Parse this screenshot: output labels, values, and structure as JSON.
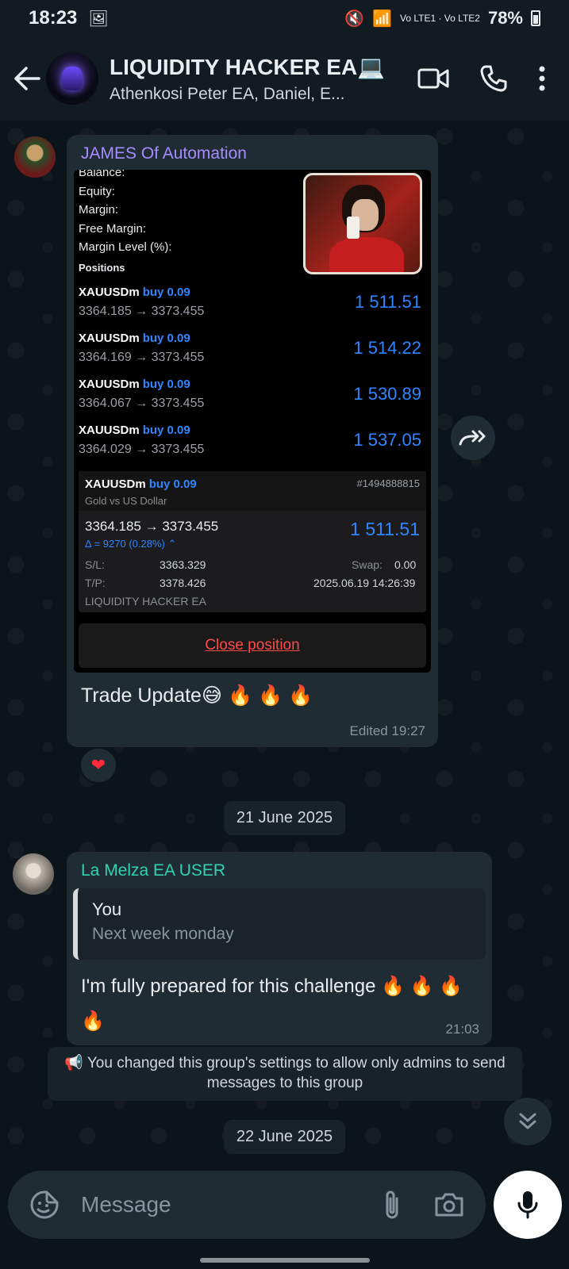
{
  "status_bar": {
    "time": "18:23",
    "network": "Vo LTE1 · Vo LTE2",
    "battery": "78%"
  },
  "header": {
    "title": "LIQUIDITY HACKER EA💻",
    "subtitle": "Athenkosi Peter EA, Daniel, E..."
  },
  "messages": {
    "first": {
      "sender": "JAMES Of Automation",
      "mt5": {
        "account_labels": [
          "Balance:",
          "Equity:",
          "Margin:",
          "Free Margin:",
          "Margin Level (%):"
        ],
        "positions_header": "Positions",
        "positions": [
          {
            "symbol": "XAUUSDm",
            "side": "buy 0.09",
            "prices": "3364.185 → 3373.455",
            "profit": "1 511.51"
          },
          {
            "symbol": "XAUUSDm",
            "side": "buy 0.09",
            "prices": "3364.169 → 3373.455",
            "profit": "1 514.22"
          },
          {
            "symbol": "XAUUSDm",
            "side": "buy 0.09",
            "prices": "3364.067 → 3373.455",
            "profit": "1 530.89"
          },
          {
            "symbol": "XAUUSDm",
            "side": "buy 0.09",
            "prices": "3364.029 → 3373.455",
            "profit": "1 537.05"
          }
        ],
        "detail": {
          "symbol": "XAUUSDm",
          "side": "buy 0.09",
          "ticket": "#1494888815",
          "description": "Gold vs US Dollar",
          "prices": "3364.185 → 3373.455",
          "delta": "Δ = 9270 (0.28%) ⌃",
          "profit": "1 511.51",
          "sl_label": "S/L:",
          "sl_value": "3363.329",
          "tp_label": "T/P:",
          "tp_value": "3378.426",
          "swap_label": "Swap:",
          "swap_value": "0.00",
          "datetime": "2025.06.19 14:26:39",
          "comment": "LIQUIDITY HACKER EA"
        },
        "close_label": "Close position"
      },
      "caption": "Trade Update😅 🔥 🔥 🔥",
      "meta": "Edited  19:27",
      "reaction": "❤"
    },
    "date_1": "21 June 2025",
    "second": {
      "sender": "La Melza EA USER",
      "quote_name": "You",
      "quote_text": "Next week monday",
      "text": "I'm fully prepared for this challenge 🔥 🔥 🔥 🔥",
      "time": "21:03"
    },
    "system": "📢 You changed this group's settings to allow only admins to send messages to this group",
    "date_2": "22 June 2025"
  },
  "composer": {
    "placeholder": "Message"
  }
}
